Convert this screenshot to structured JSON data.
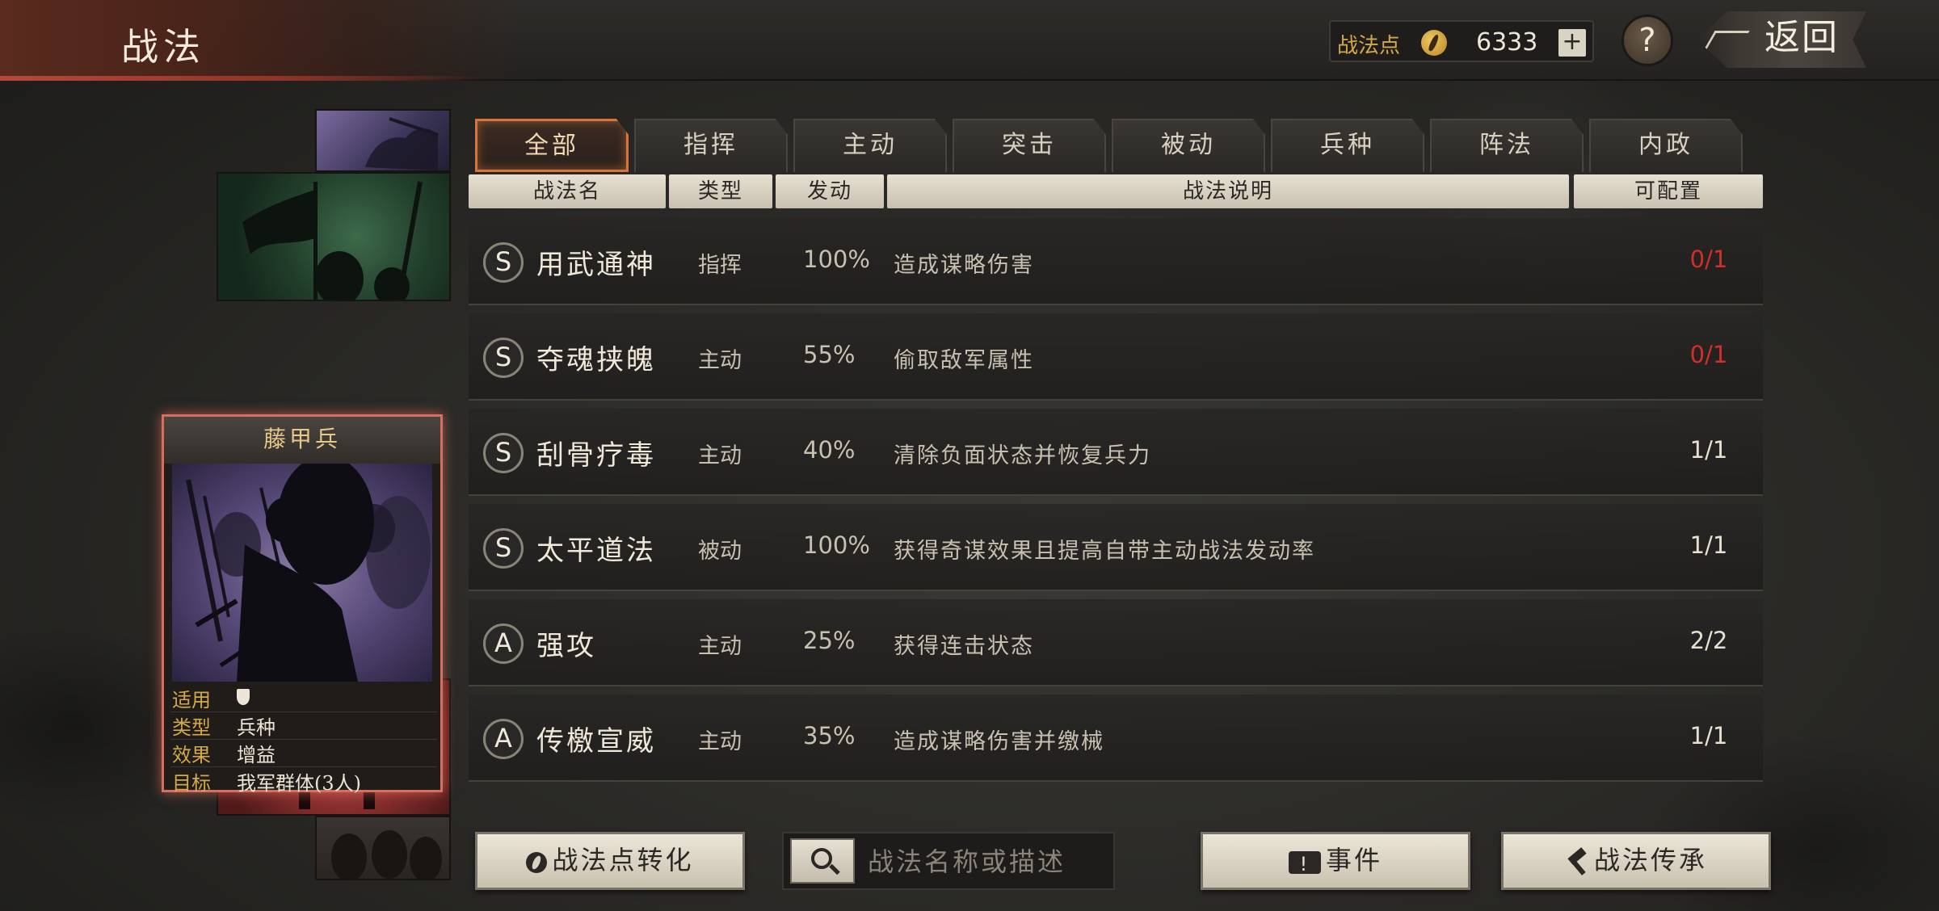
{
  "header": {
    "title": "战法",
    "points_label": "战法点",
    "points_value": "6333",
    "plus_label": "+",
    "help_label": "?",
    "back_label": "返回"
  },
  "troop_card": {
    "name": "藤甲兵",
    "stats": [
      {
        "key": "适用",
        "value": ""
      },
      {
        "key": "类型",
        "value": "兵种"
      },
      {
        "key": "效果",
        "value": "增益"
      },
      {
        "key": "目标",
        "value": "我军群体(3人)"
      }
    ]
  },
  "tabs": [
    {
      "label": "全部",
      "active": true
    },
    {
      "label": "指挥",
      "active": false
    },
    {
      "label": "主动",
      "active": false
    },
    {
      "label": "突击",
      "active": false
    },
    {
      "label": "被动",
      "active": false
    },
    {
      "label": "兵种",
      "active": false
    },
    {
      "label": "阵法",
      "active": false
    },
    {
      "label": "内政",
      "active": false
    }
  ],
  "table": {
    "headers": {
      "name": "战法名",
      "type": "类型",
      "trigger": "发动",
      "description": "战法说明",
      "configurable": "可配置"
    },
    "rows": [
      {
        "grade": "S",
        "name": "用武通神",
        "type": "指挥",
        "rate": "100%",
        "desc": "造成谋略伤害",
        "cfg": "0/1",
        "full": true
      },
      {
        "grade": "S",
        "name": "夺魂挟魄",
        "type": "主动",
        "rate": "55%",
        "desc": "偷取敌军属性",
        "cfg": "0/1",
        "full": true
      },
      {
        "grade": "S",
        "name": "刮骨疗毒",
        "type": "主动",
        "rate": "40%",
        "desc": "清除负面状态并恢复兵力",
        "cfg": "1/1",
        "full": false
      },
      {
        "grade": "S",
        "name": "太平道法",
        "type": "被动",
        "rate": "100%",
        "desc": "获得奇谋效果且提高自带主动战法发动率",
        "cfg": "1/1",
        "full": false
      },
      {
        "grade": "A",
        "name": "强攻",
        "type": "主动",
        "rate": "25%",
        "desc": "获得连击状态",
        "cfg": "2/2",
        "full": false
      },
      {
        "grade": "A",
        "name": "传檄宣威",
        "type": "主动",
        "rate": "35%",
        "desc": "造成谋略伤害并缴械",
        "cfg": "1/1",
        "full": false
      }
    ]
  },
  "footer": {
    "convert_label": "战法点转化",
    "search_placeholder": "战法名称或描述",
    "event_label": "事件",
    "inherit_label": "战法传承"
  },
  "colors": {
    "accent_red": "#d0302a",
    "tab_active_border": "#d8743e",
    "points_label": "#d4a94a"
  },
  "icons": {
    "points": "war-method-point-icon",
    "help": "help-icon",
    "back": "back-arrow-icon",
    "search": "magnifier-icon",
    "event": "event-icon",
    "inherit": "hammer-icon",
    "applicable": "shield-icon"
  }
}
